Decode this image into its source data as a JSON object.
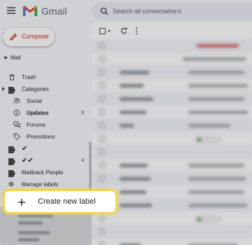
{
  "header": {
    "app_title": "Gmail",
    "search_placeholder": "Search all conversations"
  },
  "compose": {
    "label": "Compose"
  },
  "sidebar": {
    "mail_heading": "Mail",
    "items": [
      {
        "label": "Trash",
        "icon": "trash-icon"
      },
      {
        "label": "Categories",
        "icon": "label-icon"
      },
      {
        "label": "Social",
        "icon": "people-icon"
      },
      {
        "label": "Updates",
        "icon": "info-icon",
        "count": "6"
      },
      {
        "label": "Forums",
        "icon": "forum-icon"
      },
      {
        "label": "Promotions",
        "icon": "tag-icon"
      },
      {
        "label": "✔",
        "icon": "label-icon"
      },
      {
        "label": "✔✔",
        "icon": "label-icon",
        "count": "4"
      },
      {
        "label": "Mailtrack People",
        "icon": "label-icon"
      },
      {
        "label": "Manage labels",
        "icon": "gear-icon"
      }
    ]
  },
  "highlight": {
    "label": "Create new label",
    "icon": "plus-icon",
    "border_color": "#f6d24b"
  },
  "colors": {
    "compose_accent": "#c5221f",
    "background": "#f6f8fc"
  }
}
